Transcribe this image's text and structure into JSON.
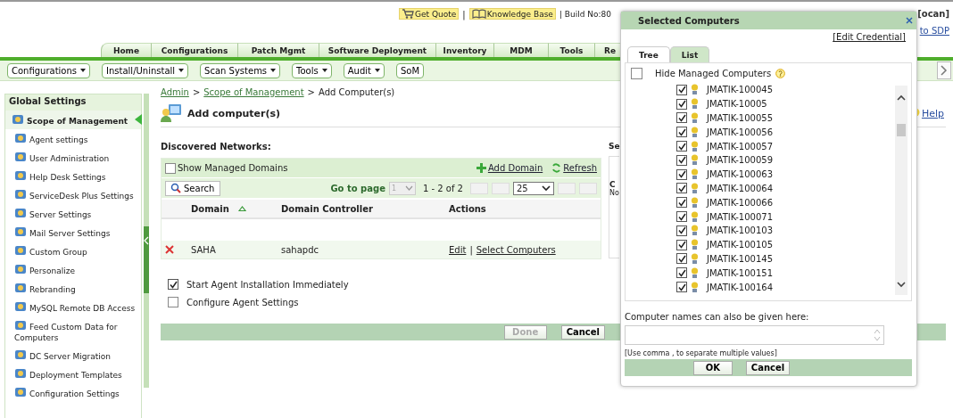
{
  "header": {
    "links": [
      {
        "label": "Get Quote",
        "kind": "cart"
      },
      {
        "label": "Knowledge Base",
        "kind": "book"
      }
    ],
    "separator": "|",
    "build": "| Build No:80",
    "user": "[ocan]",
    "sdp_link": "to SDP"
  },
  "main_tabs": [
    {
      "label": "Home"
    },
    {
      "label": "Configurations"
    },
    {
      "label": "Patch Mgmt"
    },
    {
      "label": "Software Deployment"
    },
    {
      "label": "Inventory"
    },
    {
      "label": "MDM"
    },
    {
      "label": "Tools"
    },
    {
      "label": "Re"
    }
  ],
  "menu": [
    {
      "label": "Configurations",
      "dropdown": true
    },
    {
      "label": "Install/Uninstall",
      "dropdown": true
    },
    {
      "label": "Scan Systems",
      "dropdown": true
    },
    {
      "label": "Tools",
      "dropdown": true
    },
    {
      "label": "Audit",
      "dropdown": true
    },
    {
      "label": "SoM",
      "dropdown": false
    }
  ],
  "sidebar": {
    "title": "Global Settings",
    "items": [
      {
        "label": "Scope of Management",
        "selected": true
      },
      {
        "label": "Agent settings",
        "selected": false
      },
      {
        "label": "User Administration",
        "selected": false
      },
      {
        "label": "Help Desk Settings",
        "selected": false
      },
      {
        "label": "ServiceDesk Plus Settings",
        "selected": false
      },
      {
        "label": "Server Settings",
        "selected": false
      },
      {
        "label": "Mail Server Settings",
        "selected": false
      },
      {
        "label": "Custom Group",
        "selected": false
      },
      {
        "label": "Personalize",
        "selected": false
      },
      {
        "label": "Rebranding",
        "selected": false
      },
      {
        "label": "MySQL Remote DB Access",
        "selected": false
      },
      {
        "label": "Feed Custom Data for Computers",
        "selected": false
      },
      {
        "label": "DC Server Migration",
        "selected": false
      },
      {
        "label": "Deployment Templates",
        "selected": false
      },
      {
        "label": "Configuration Settings",
        "selected": false
      }
    ]
  },
  "breadcrumb": {
    "links": [
      "Admin",
      "Scope of Management"
    ],
    "current": "Add Computer(s)",
    "separator": ">"
  },
  "page_title": "Add computer(s)",
  "help": "Help",
  "networks": {
    "title": "Discovered Networks:",
    "show_managed": {
      "label": "Show Managed Domains",
      "checked": false
    },
    "add_domain": "Add Domain",
    "refresh": "Refresh",
    "search": "Search",
    "goto_label": "Go to page",
    "page": "1",
    "range": "1 - 2 of 2",
    "per_page": "25",
    "columns": [
      "Domain",
      "Domain Controller",
      "Actions"
    ],
    "rows": [
      {
        "domain": "SAHA",
        "controller": "sahapdc",
        "actions": [
          "Edit",
          "Select Computers"
        ],
        "separator": "|"
      }
    ]
  },
  "side_panel": {
    "heading": "Se",
    "column": "C",
    "note": "No"
  },
  "options": [
    {
      "label": "Start Agent Installation Immediately",
      "checked": true
    },
    {
      "label": "Configure Agent Settings",
      "checked": false
    }
  ],
  "buttons": [
    {
      "label": "Done",
      "disabled": true
    },
    {
      "label": "Cancel",
      "disabled": false
    }
  ],
  "dialog": {
    "title": "Selected Computers",
    "edit_credential": "[Edit Credential]",
    "tabs": [
      {
        "label": "Tree",
        "selected": true
      },
      {
        "label": "List",
        "selected": false
      }
    ],
    "hide_managed": {
      "label": "Hide Managed Computers",
      "checked": false
    },
    "computers": [
      {
        "name": "JMATIK-100045",
        "checked": true
      },
      {
        "name": "JMATIK-10005",
        "checked": true
      },
      {
        "name": "JMATIK-100055",
        "checked": true
      },
      {
        "name": "JMATIK-100056",
        "checked": true
      },
      {
        "name": "JMATIK-100057",
        "checked": true
      },
      {
        "name": "JMATIK-100059",
        "checked": true
      },
      {
        "name": "JMATIK-100063",
        "checked": true
      },
      {
        "name": "JMATIK-100064",
        "checked": true
      },
      {
        "name": "JMATIK-100066",
        "checked": true
      },
      {
        "name": "JMATIK-100071",
        "checked": true
      },
      {
        "name": "JMATIK-100103",
        "checked": true
      },
      {
        "name": "JMATIK-100105",
        "checked": true
      },
      {
        "name": "JMATIK-100145",
        "checked": true
      },
      {
        "name": "JMATIK-100151",
        "checked": true
      },
      {
        "name": "JMATIK-100164",
        "checked": true
      }
    ],
    "names_label": "Computer names can also be given here:",
    "hint": "[Use comma , to separate multiple values]",
    "buttons": [
      "OK",
      "Cancel"
    ]
  }
}
